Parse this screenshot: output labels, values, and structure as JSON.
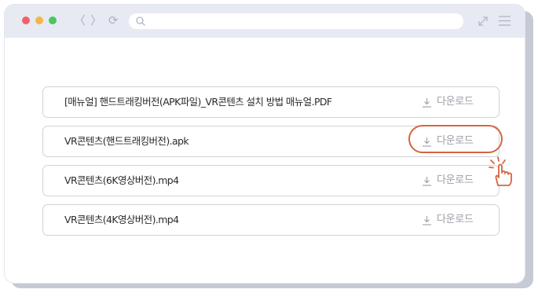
{
  "browser": {
    "url_value": "",
    "nav_back_glyph": "〈",
    "nav_forward_glyph": "〉",
    "nav_reload_glyph": "⟳",
    "icons": [
      "close-dot",
      "minimize-dot",
      "maximize-dot",
      "back-icon",
      "forward-icon",
      "reload-icon",
      "search-icon",
      "expand-icon",
      "menu-icon"
    ]
  },
  "downloads": {
    "button_label": "다운로드",
    "files": [
      {
        "name": "[매뉴얼] 핸드트래킹버전(APK파일)_VR콘텐츠 설치 방법 매뉴얼.PDF",
        "button": "다운로드",
        "highlighted": false
      },
      {
        "name": "VR콘텐츠(핸드트래킹버전).apk",
        "button": "다운로드",
        "highlighted": true
      },
      {
        "name": "VR콘텐츠(6K영상버전).mp4",
        "button": "다운로드",
        "highlighted": false
      },
      {
        "name": "VR콘텐츠(4K영상버전).mp4",
        "button": "다운로드",
        "highlighted": false
      }
    ]
  },
  "colors": {
    "titlebar": "#e7eaf3",
    "highlight": "#d5653f",
    "cursor": "#d5653f",
    "row_border": "#cfd2d8",
    "button_text": "#9a9ea6"
  },
  "cursor": {
    "icon": "hand-pointer-click-icon"
  }
}
